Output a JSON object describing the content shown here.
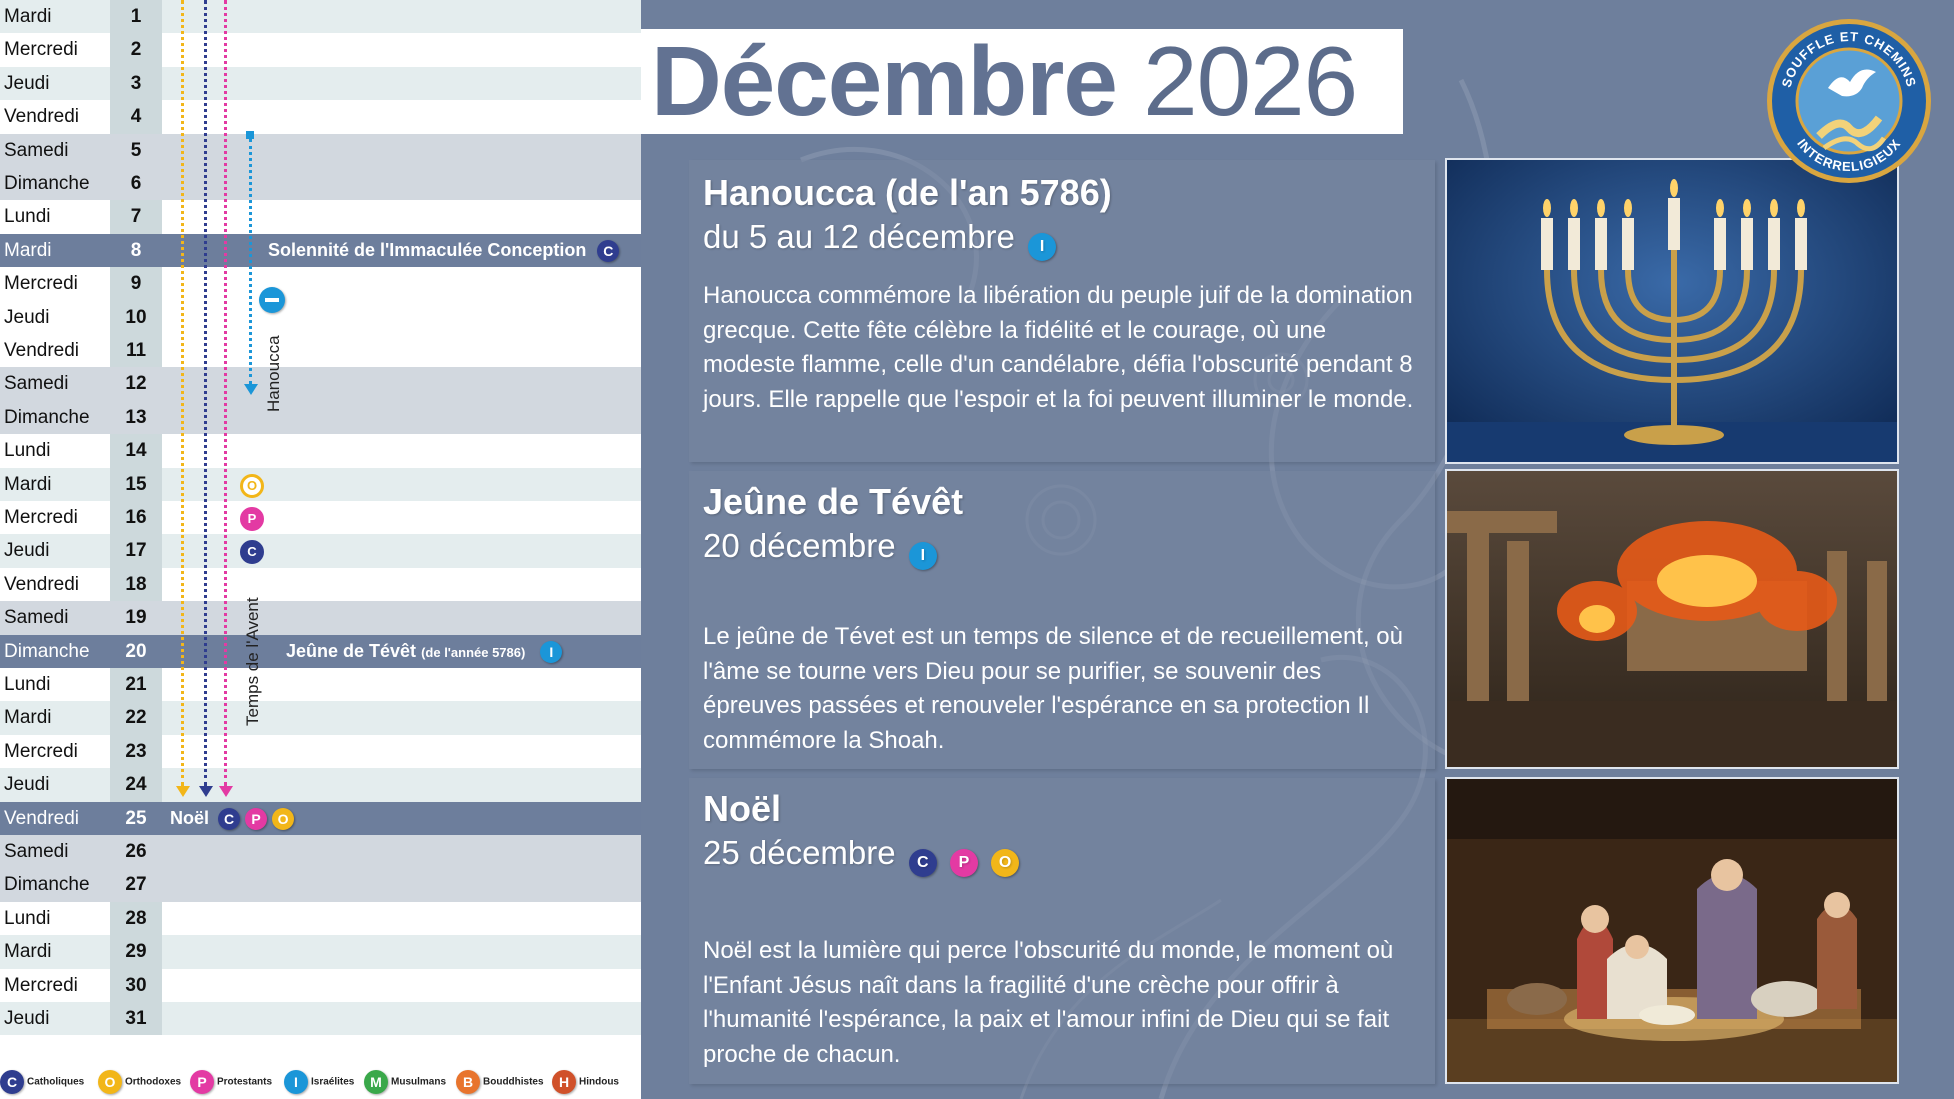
{
  "calendar": {
    "days": [
      {
        "day": "Mardi",
        "num": "1"
      },
      {
        "day": "Mercredi",
        "num": "2"
      },
      {
        "day": "Jeudi",
        "num": "3"
      },
      {
        "day": "Vendredi",
        "num": "4"
      },
      {
        "day": "Samedi",
        "num": "5"
      },
      {
        "day": "Dimanche",
        "num": "6"
      },
      {
        "day": "Lundi",
        "num": "7"
      },
      {
        "day": "Mardi",
        "num": "8"
      },
      {
        "day": "Mercredi",
        "num": "9"
      },
      {
        "day": "Jeudi",
        "num": "10"
      },
      {
        "day": "Vendredi",
        "num": "11"
      },
      {
        "day": "Samedi",
        "num": "12"
      },
      {
        "day": "Dimanche",
        "num": "13"
      },
      {
        "day": "Lundi",
        "num": "14"
      },
      {
        "day": "Mardi",
        "num": "15"
      },
      {
        "day": "Mercredi",
        "num": "16"
      },
      {
        "day": "Jeudi",
        "num": "17"
      },
      {
        "day": "Vendredi",
        "num": "18"
      },
      {
        "day": "Samedi",
        "num": "19"
      },
      {
        "day": "Dimanche",
        "num": "20"
      },
      {
        "day": "Lundi",
        "num": "21"
      },
      {
        "day": "Mardi",
        "num": "22"
      },
      {
        "day": "Mercredi",
        "num": "23"
      },
      {
        "day": "Jeudi",
        "num": "24"
      },
      {
        "day": "Vendredi",
        "num": "25"
      },
      {
        "day": "Samedi",
        "num": "26"
      },
      {
        "day": "Dimanche",
        "num": "27"
      },
      {
        "day": "Lundi",
        "num": "28"
      },
      {
        "day": "Mardi",
        "num": "29"
      },
      {
        "day": "Mercredi",
        "num": "30"
      },
      {
        "day": "Jeudi",
        "num": "31"
      }
    ],
    "events": {
      "immaculee": "Solennité de l'Immaculée Conception",
      "tevet_main": "Jeûne de Tévêt",
      "tevet_small": "(de l'année 5786)",
      "noel": "Noël"
    },
    "period_labels": {
      "hanoucca": "Hanoucca",
      "avent": "Temps de l'Avent"
    },
    "badges": {
      "c": "C",
      "o": "O",
      "p": "P",
      "i": "I",
      "m": "M",
      "b": "B",
      "h": "H"
    }
  },
  "legend": [
    {
      "letter": "C",
      "label": "Catholiques",
      "color": "#2f3d8f"
    },
    {
      "letter": "O",
      "label": "Orthodoxes",
      "color": "#f2b619"
    },
    {
      "letter": "P",
      "label": "Protestants",
      "color": "#e33aa3"
    },
    {
      "letter": "I",
      "label": "Israélites",
      "color": "#1b96d8"
    },
    {
      "letter": "M",
      "label": "Musulmans",
      "color": "#3aa84a"
    },
    {
      "letter": "B",
      "label": "Bouddhistes",
      "color": "#e8742d"
    },
    {
      "letter": "H",
      "label": "Hindous",
      "color": "#d0512a"
    }
  ],
  "header": {
    "month": "Décembre",
    "year": "2026"
  },
  "cards": [
    {
      "title": "Hanoucca (de l'an 5786)",
      "date": "du 5  au 12 décembre",
      "description": "Hanoucca commémore la libération du peuple juif  de la domination grecque. Cette fête célèbre la fidélité et le courage, où une modeste flamme, celle d'un candélabre, défia l'obscurité pendant 8 jours. Elle rappelle que l'espoir et la foi peuvent illuminer le monde."
    },
    {
      "title": "Jeûne de Tévêt",
      "date": "20 décembre",
      "description": "Le jeûne de Tévet est un temps de silence et de recueillement, où l'âme se tourne vers Dieu pour se purifier, se souvenir des épreuves passées et renouveler l'espérance en sa protection  Il commémore la Shoah."
    },
    {
      "title": "Noël",
      "date": "25 décembre",
      "description": "Noël est la lumière qui perce l'obscurité du monde, le moment où l'Enfant Jésus naît dans la fragilité d'une crèche pour offrir à l'humanité l'espérance, la paix et l'amour infini de Dieu qui se fait proche de chacun."
    }
  ],
  "logo": {
    "top_text": "SOUFFLE ET CHEMINS",
    "bottom_text": "INTERRELIGIEUX"
  },
  "colors": {
    "panel_bg": "#6e7f9c",
    "highlight_row": "#6d7e9c",
    "catholic": "#2f3d8f",
    "orthodox": "#f2b619",
    "protestant": "#e33aa3",
    "israelite": "#1b96d8"
  }
}
